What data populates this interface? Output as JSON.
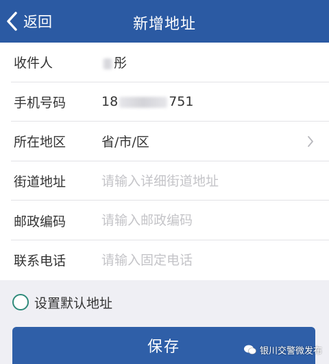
{
  "nav": {
    "back_label": "返回",
    "title": "新增地址"
  },
  "form": {
    "recipient": {
      "label": "收件人",
      "value_visible": "彤"
    },
    "phone": {
      "label": "手机号码",
      "prefix": "18",
      "suffix": "751"
    },
    "region": {
      "label": "所在地区",
      "value": "省/市/区"
    },
    "street": {
      "label": "街道地址",
      "placeholder": "请输入详细街道地址"
    },
    "postcode": {
      "label": "邮政编码",
      "placeholder": "请输入邮政编码"
    },
    "telephone": {
      "label": "联系电话",
      "placeholder": "请输入固定电话"
    }
  },
  "default_address_label": "设置默认地址",
  "save_label": "保存",
  "watermark": "银川交警微发布",
  "colors": {
    "navbar": "#2b5aa3",
    "button": "#2f5fa8",
    "radio_border": "#2e8a7a",
    "placeholder": "#c4c4c8"
  },
  "icons": {
    "back": "chevron-left-icon",
    "region_arrow": "chevron-right-icon",
    "watermark": "wechat-icon"
  }
}
